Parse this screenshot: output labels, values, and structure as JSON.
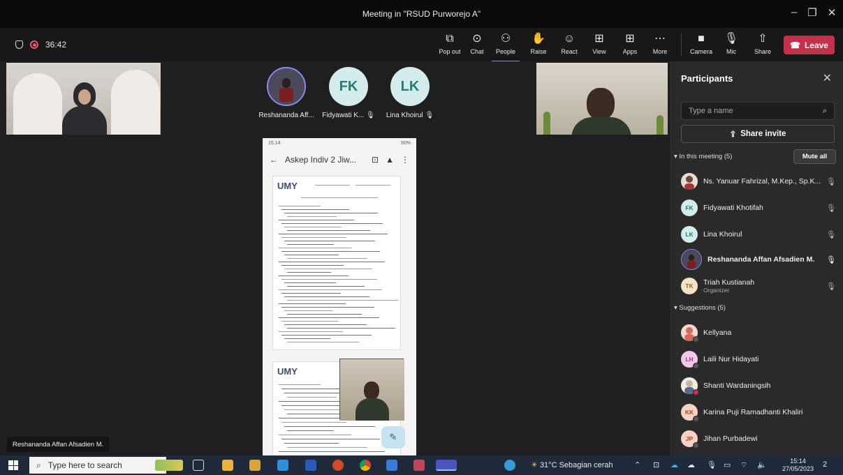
{
  "window": {
    "title": "Meeting in \"RSUD Purworejo A\"",
    "minimize_icon": "minimize-icon",
    "restore_icon": "restore-icon",
    "close_icon": "close-icon"
  },
  "toolbar": {
    "timer": "36:42",
    "buttons": [
      {
        "label": "Pop out",
        "icon": "⧉"
      },
      {
        "label": "Chat",
        "icon": "☺"
      },
      {
        "label": "People",
        "icon": "⚇"
      },
      {
        "label": "Raise",
        "icon": "✋"
      },
      {
        "label": "React",
        "icon": "☺"
      },
      {
        "label": "View",
        "icon": "⊞"
      },
      {
        "label": "Apps",
        "icon": "⊞"
      },
      {
        "label": "More",
        "icon": "⋯"
      },
      {
        "label": "Camera",
        "icon": "■"
      },
      {
        "label": "Mic",
        "icon": "🎙"
      },
      {
        "label": "Share",
        "icon": "⇧"
      }
    ],
    "leave_label": "Leave"
  },
  "stage": {
    "tiles": [
      {
        "label": "Reshananda Aff...",
        "initials": "",
        "color": "#3a3a50"
      },
      {
        "label": "Fidyawati K...",
        "initials": "FK",
        "color": "#d4eceb"
      },
      {
        "label": "Lina Khoirul",
        "initials": "LK",
        "color": "#d4eceb"
      }
    ],
    "phone": {
      "status_time": "15.14",
      "status_right": "50%",
      "doc_title": "Askep Indiv 2 Jiw...",
      "logo": "UMY",
      "logo2": "UMY"
    },
    "name_tag": "Reshananda Affan Afsadien M."
  },
  "panel": {
    "title": "Participants",
    "search_placeholder": "Type a name",
    "share_label": "Share invite",
    "in_meeting": "In this meeting (5)",
    "mute_all": "Mute all",
    "participants": [
      {
        "name": "Ns. Yanuar Fahrizal, M.Kep., Sp.K...",
        "initials": "",
        "color": "#7b5a4a",
        "sub": "",
        "bold": false
      },
      {
        "name": "Fidyawati Khotifah",
        "initials": "FK",
        "color": "#d4eceb",
        "sub": "",
        "bold": false
      },
      {
        "name": "Lina Khoirul",
        "initials": "LK",
        "color": "#d4eceb",
        "sub": "",
        "bold": false
      },
      {
        "name": "Reshananda Affan Afsadien M.",
        "initials": "",
        "color": "#3a3a50",
        "sub": "",
        "bold": true
      },
      {
        "name": "Triah Kustianah",
        "initials": "TK",
        "color": "#f6e3c6",
        "sub": "Organizer",
        "bold": false
      }
    ],
    "suggestions_label": "Suggestions (5)",
    "suggestions": [
      {
        "name": "Kellyana",
        "initials": "",
        "color": "#e8a19a"
      },
      {
        "name": "Laili Nur Hidayati",
        "initials": "LH",
        "color": "#f0c8e8"
      },
      {
        "name": "Shanti Wardaningsih",
        "initials": "",
        "color": "#e8e2d6"
      },
      {
        "name": "Karina Puji Ramadhanti Khaliri",
        "initials": "KK",
        "color": "#f7d2c4"
      },
      {
        "name": "Jihan Purbadewi",
        "initials": "JP",
        "color": "#f7d2c4"
      }
    ]
  },
  "taskbar": {
    "search_placeholder": "Type here to search",
    "weather": "31°C  Sebagian cerah",
    "time": "15:14",
    "date": "27/05/2023",
    "notif_count": "2"
  }
}
